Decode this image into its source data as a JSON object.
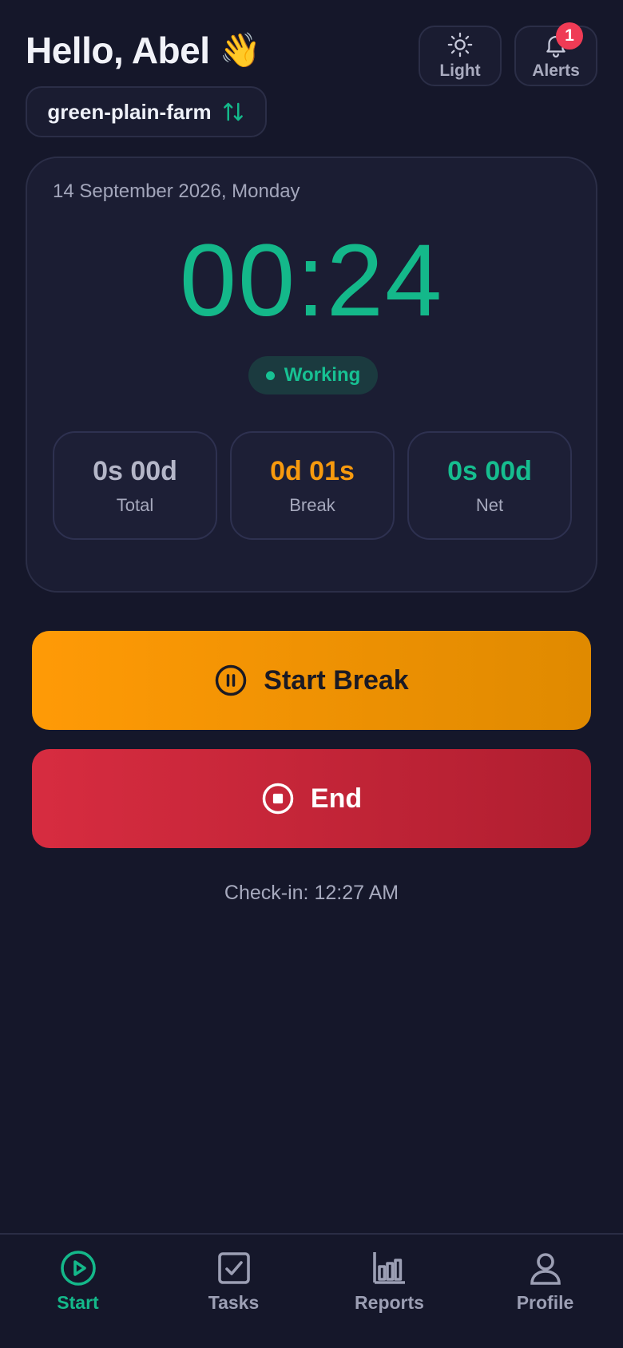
{
  "header": {
    "greeting": "Hello, Abel",
    "wave_emoji": "👋",
    "theme_button": {
      "label": "Light",
      "icon": "sun-icon"
    },
    "alerts_button": {
      "label": "Alerts",
      "icon": "bell-icon",
      "badge_count": "1"
    },
    "farm_selector": {
      "label": "green-plain-farm",
      "icon": "swap-vertical-icon"
    }
  },
  "session": {
    "date": "14 September 2026, Monday",
    "timer": "00:24",
    "status": "Working",
    "stats": [
      {
        "value": "0s 00d",
        "label": "Total"
      },
      {
        "value": "0d 01s",
        "label": "Break"
      },
      {
        "value": "0s 00d",
        "label": "Net"
      }
    ]
  },
  "actions": {
    "break_label": "Start Break",
    "end_label": "End"
  },
  "checkin": "Check-in: 12:27 AM",
  "nav": {
    "items": [
      {
        "label": "Start",
        "icon": "play-circle-icon",
        "active": true
      },
      {
        "label": "Tasks",
        "icon": "checkbox-icon",
        "active": false
      },
      {
        "label": "Reports",
        "icon": "bar-chart-icon",
        "active": false
      },
      {
        "label": "Profile",
        "icon": "user-icon",
        "active": false
      }
    ]
  },
  "colors": {
    "background": "#15172a",
    "accent_green": "#14b88a",
    "break_orange": "#ff9a06",
    "end_red": "#d72c40",
    "badge_red": "#ef3b55"
  }
}
